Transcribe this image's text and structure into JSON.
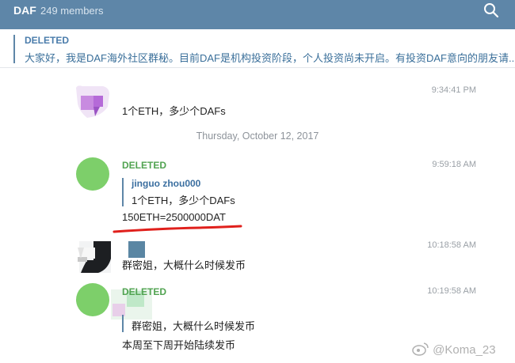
{
  "header": {
    "title": "DAF",
    "members": "249 members",
    "search_icon": "search-icon"
  },
  "pinned": {
    "name": "DELETED",
    "text": "大家好，我是DAF海外社区群秘。目前DAF是机构投资阶段，个人投资尚未开启。有投资DAF意向的朋友请..."
  },
  "messages": [
    {
      "time": "9:34:41 PM",
      "text": "1个ETH，多少个DAFs"
    },
    {
      "date_separator": "Thursday, October 12, 2017"
    },
    {
      "sender": "DELETED",
      "time": "9:59:18 AM",
      "quote": {
        "name": "jinguo zhou000",
        "text": "1个ETH，多少个DAFs"
      },
      "text": "150ETH=2500000DAT"
    },
    {
      "time": "10:18:58 AM",
      "text": "群密姐，大概什么时候发币"
    },
    {
      "sender": "DELETED",
      "time": "10:19:58 AM",
      "quote_text": "群密姐，大概什么时候发币",
      "text": "本周至下周开始陆续发币"
    }
  ],
  "watermark": "@Koma_23",
  "colors": {
    "header_bg": "#5e86a8",
    "deleted_sender": "#51a351",
    "avatar_green": "#7dcf6a",
    "annotation_red": "#e0201c"
  }
}
